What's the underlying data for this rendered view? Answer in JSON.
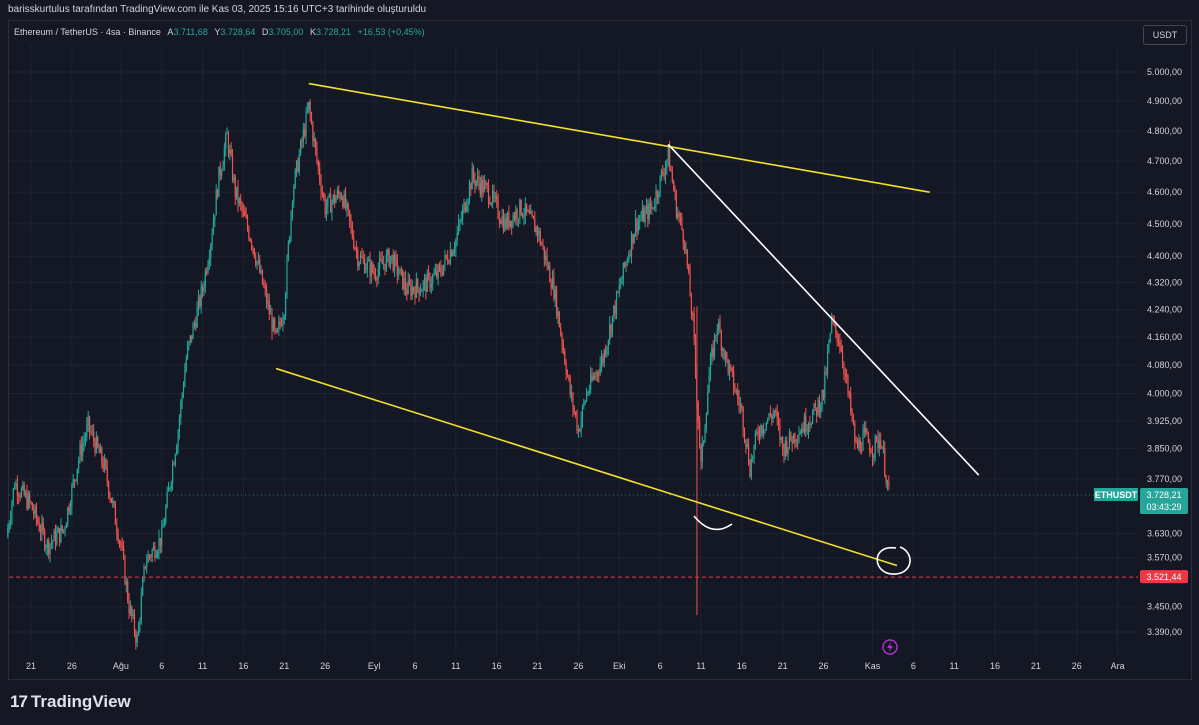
{
  "attribution": "barisskurtulus tarafından TradingView.com ile Kas 03, 2025 15:16 UTC+3 tarihinde oluşturuldu",
  "legend": {
    "symbol": "Ethereum / TetherUS · 4sa · Binance",
    "open_label": "A",
    "open": "3.711,68",
    "high_label": "Y",
    "high": "3.728,64",
    "low_label": "D",
    "low": "3.705,00",
    "close_label": "K",
    "close": "3.728,21",
    "change": "+16,53 (+0,45%)"
  },
  "currency_button": "USDT",
  "brand": "TradingView",
  "colors": {
    "up": "#26a69a",
    "down": "#ef5350",
    "trend_yellow": "#f2e12e",
    "trend_white": "#ffffff",
    "price_tag": "#26a69a",
    "support_tag": "#f23645",
    "background": "#141824"
  },
  "chart_data": {
    "type": "candlestick",
    "symbol": "ETHUSDT",
    "y_ticks": [
      "5.000,00",
      "4.900,00",
      "4.800,00",
      "4.700,00",
      "4.600,00",
      "4.500,00",
      "4.400,00",
      "4.320,00",
      "4.240,00",
      "4.160,00",
      "4.080,00",
      "4.000,00",
      "3.925,00",
      "3.850,00",
      "3.770,00",
      "3.630,00",
      "3.570,00",
      "3.450,00",
      "3.390,00"
    ],
    "y_tick_values": [
      5000,
      4900,
      4800,
      4700,
      4600,
      4500,
      4400,
      4320,
      4240,
      4160,
      4080,
      4000,
      3925,
      3850,
      3770,
      3630,
      3570,
      3450,
      3390
    ],
    "x_ticks": [
      "21",
      "26",
      "Ağu",
      "6",
      "11",
      "16",
      "21",
      "26",
      "Eyl",
      "6",
      "11",
      "16",
      "21",
      "26",
      "Eki",
      "6",
      "11",
      "16",
      "21",
      "26",
      "Kas",
      "6",
      "11",
      "16",
      "21",
      "26",
      "Ara"
    ],
    "x_tick_dates": [
      "2025-07-21",
      "2025-07-26",
      "2025-08-01",
      "2025-08-06",
      "2025-08-11",
      "2025-08-16",
      "2025-08-21",
      "2025-08-26",
      "2025-09-01",
      "2025-09-06",
      "2025-09-11",
      "2025-09-16",
      "2025-09-21",
      "2025-09-26",
      "2025-10-01",
      "2025-10-06",
      "2025-10-11",
      "2025-10-16",
      "2025-10-21",
      "2025-10-26",
      "2025-11-01",
      "2025-11-06",
      "2025-11-11",
      "2025-11-16",
      "2025-11-21",
      "2025-11-26",
      "2025-12-01"
    ],
    "price_path": [
      [
        "2025-07-18",
        3620
      ],
      [
        "2025-07-19",
        3760
      ],
      [
        "2025-07-21",
        3700
      ],
      [
        "2025-07-23",
        3600
      ],
      [
        "2025-07-25",
        3640
      ],
      [
        "2025-07-27",
        3840
      ],
      [
        "2025-07-28",
        3910
      ],
      [
        "2025-07-30",
        3800
      ],
      [
        "2025-08-01",
        3600
      ],
      [
        "2025-08-02",
        3450
      ],
      [
        "2025-08-03",
        3370
      ],
      [
        "2025-08-04",
        3560
      ],
      [
        "2025-08-06",
        3620
      ],
      [
        "2025-08-08",
        3900
      ],
      [
        "2025-08-09",
        4100
      ],
      [
        "2025-08-11",
        4300
      ],
      [
        "2025-08-12",
        4450
      ],
      [
        "2025-08-13",
        4650
      ],
      [
        "2025-08-14",
        4780
      ],
      [
        "2025-08-15",
        4600
      ],
      [
        "2025-08-17",
        4450
      ],
      [
        "2025-08-19",
        4250
      ],
      [
        "2025-08-20",
        4150
      ],
      [
        "2025-08-21",
        4250
      ],
      [
        "2025-08-22",
        4600
      ],
      [
        "2025-08-24",
        4880
      ],
      [
        "2025-08-25",
        4700
      ],
      [
        "2025-08-26",
        4550
      ],
      [
        "2025-08-28",
        4600
      ],
      [
        "2025-08-30",
        4400
      ],
      [
        "2025-09-01",
        4350
      ],
      [
        "2025-09-03",
        4400
      ],
      [
        "2025-09-05",
        4300
      ],
      [
        "2025-09-07",
        4310
      ],
      [
        "2025-09-09",
        4350
      ],
      [
        "2025-09-11",
        4450
      ],
      [
        "2025-09-13",
        4650
      ],
      [
        "2025-09-15",
        4600
      ],
      [
        "2025-09-17",
        4500
      ],
      [
        "2025-09-19",
        4550
      ],
      [
        "2025-09-21",
        4480
      ],
      [
        "2025-09-23",
        4300
      ],
      [
        "2025-09-25",
        4000
      ],
      [
        "2025-09-26",
        3900
      ],
      [
        "2025-09-27",
        4000
      ],
      [
        "2025-09-29",
        4100
      ],
      [
        "2025-10-01",
        4300
      ],
      [
        "2025-10-03",
        4500
      ],
      [
        "2025-10-05",
        4550
      ],
      [
        "2025-10-07",
        4720
      ],
      [
        "2025-10-08",
        4550
      ],
      [
        "2025-10-09",
        4450
      ],
      [
        "2025-10-10",
        4200
      ],
      [
        "2025-10-11",
        3800
      ],
      [
        "2025-10-12",
        4050
      ],
      [
        "2025-10-13",
        4200
      ],
      [
        "2025-10-14",
        4100
      ],
      [
        "2025-10-16",
        3950
      ],
      [
        "2025-10-17",
        3800
      ],
      [
        "2025-10-18",
        3900
      ],
      [
        "2025-10-20",
        3950
      ],
      [
        "2025-10-21",
        3850
      ],
      [
        "2025-10-23",
        3900
      ],
      [
        "2025-10-25",
        3950
      ],
      [
        "2025-10-26",
        4000
      ],
      [
        "2025-10-27",
        4200
      ],
      [
        "2025-10-28",
        4150
      ],
      [
        "2025-10-29",
        4000
      ],
      [
        "2025-10-30",
        3850
      ],
      [
        "2025-10-31",
        3880
      ],
      [
        "2025-11-01",
        3850
      ],
      [
        "2025-11-02",
        3880
      ],
      [
        "2025-11-03",
        3728.21
      ]
    ],
    "annotations": {
      "lower_channel_line": [
        [
          "2025-08-20",
          4070
        ],
        [
          "2025-11-04",
          3550
        ]
      ],
      "upper_channel_line": [
        [
          "2025-08-24",
          4960
        ],
        [
          "2025-11-08",
          4600
        ]
      ],
      "falling_white_line": [
        [
          "2025-10-07",
          4755
        ],
        [
          "2025-11-14",
          3780
        ]
      ]
    },
    "current_price": {
      "label": "ETHUSDT",
      "value": "3.728,21",
      "countdown": "03:43:29",
      "numeric": 3728.21
    },
    "support_level": {
      "value": "3.521,44",
      "numeric": 3521.44
    }
  }
}
